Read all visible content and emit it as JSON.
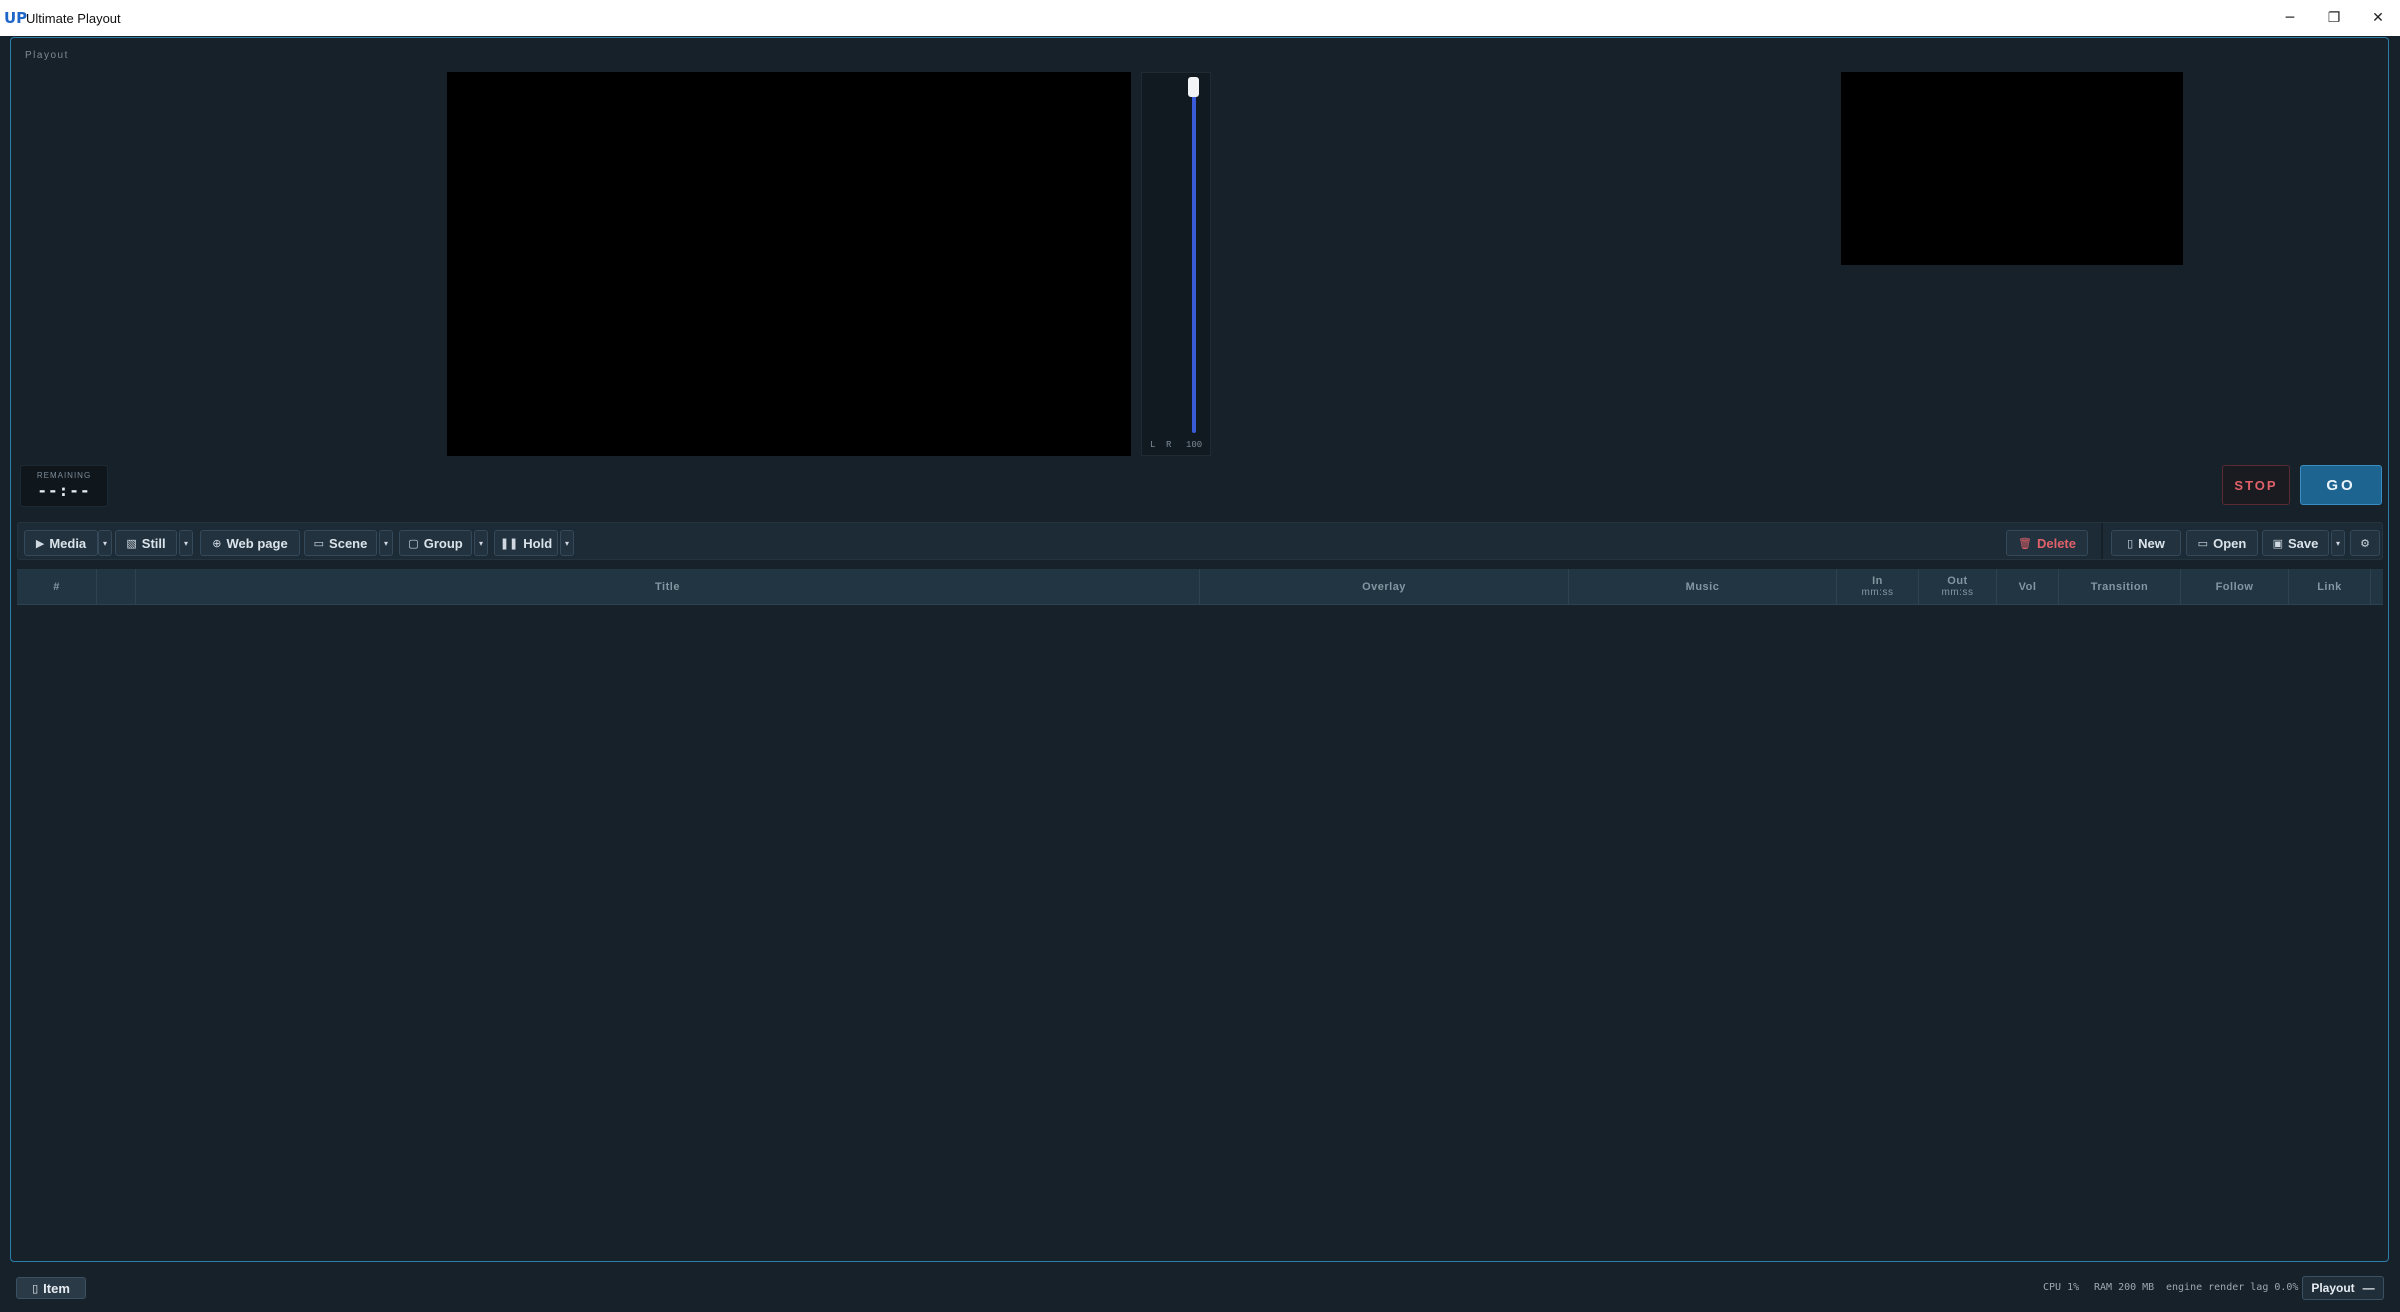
{
  "window": {
    "title": "Ultimate Playout",
    "logo": "UP",
    "controls": {
      "minimize": "─",
      "restore": "❐",
      "close": "✕"
    }
  },
  "panel": {
    "label": "Playout"
  },
  "meter": {
    "left": "L",
    "right": "R",
    "value": "100"
  },
  "remaining": {
    "label": "REMAINING",
    "time": "--:--"
  },
  "transport": {
    "stop": "STOP",
    "go": "GO"
  },
  "toolbar": {
    "media": "Media",
    "still": "Still",
    "webpage": "Web page",
    "scene": "Scene",
    "group": "Group",
    "hold": "Hold",
    "delete": "Delete",
    "new": "New",
    "open": "Open",
    "save": "Save",
    "caret": "▾",
    "icons": {
      "media": "▶",
      "still": "▧",
      "webpage": "⊕",
      "scene": "▭",
      "group": "▢",
      "hold": "❚❚",
      "delete": "🗑",
      "new": "▯",
      "open": "▭",
      "save": "▣",
      "settings": "⚙"
    }
  },
  "table": {
    "columns": {
      "num": "#",
      "title": "Title",
      "overlay": "Overlay",
      "music": "Music",
      "in": "In",
      "in_sub": "mm:ss",
      "out": "Out",
      "out_sub": "mm:ss",
      "vol": "Vol",
      "transition": "Transition",
      "follow": "Follow",
      "link": "Link"
    },
    "rows": []
  },
  "status": {
    "item": "Item",
    "item_icon": "▯",
    "cpu": "CPU 1%",
    "ram": "RAM 200 MB",
    "lag": "engine render lag 0.0%",
    "playout": "Playout",
    "playout_icon": "—"
  },
  "colors": {
    "accent": "#1e6491",
    "stop": "#e0616a",
    "background": "#172129",
    "meter": "#3a5bd8"
  }
}
